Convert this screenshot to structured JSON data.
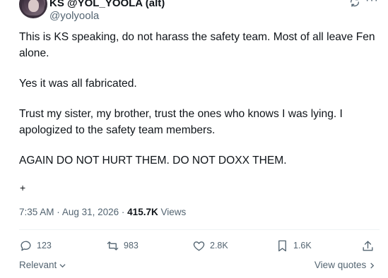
{
  "author": {
    "display_name": "KS @YOL_YOOLA (alt)",
    "handle": "@yolyoola"
  },
  "tweet": {
    "paragraphs": [
      "This is KS speaking, do not harass the safety team. Most of all leave Fen alone.",
      "Yes it was all fabricated.",
      "Trust my sister, my brother, trust the ones who knows I was lying. I apologized to the safety team members.",
      "AGAIN DO NOT HURT THEM. DO NOT DOXX THEM."
    ],
    "extra": "+"
  },
  "meta": {
    "time": "7:35 AM",
    "separator": "·",
    "date": "Aug 31, 2026",
    "views_count": "415.7K",
    "views_label": "Views"
  },
  "actions": {
    "replies": "123",
    "reposts": "983",
    "likes": "2.8K",
    "bookmarks": "1.6K"
  },
  "footer": {
    "sort_label": "Relevant",
    "view_quotes_label": "View quotes"
  },
  "icons": [
    "grok-icon",
    "more-icon",
    "reply-icon",
    "repost-icon",
    "like-icon",
    "bookmark-icon",
    "share-icon",
    "chevron-down-icon",
    "chevron-right-icon"
  ]
}
